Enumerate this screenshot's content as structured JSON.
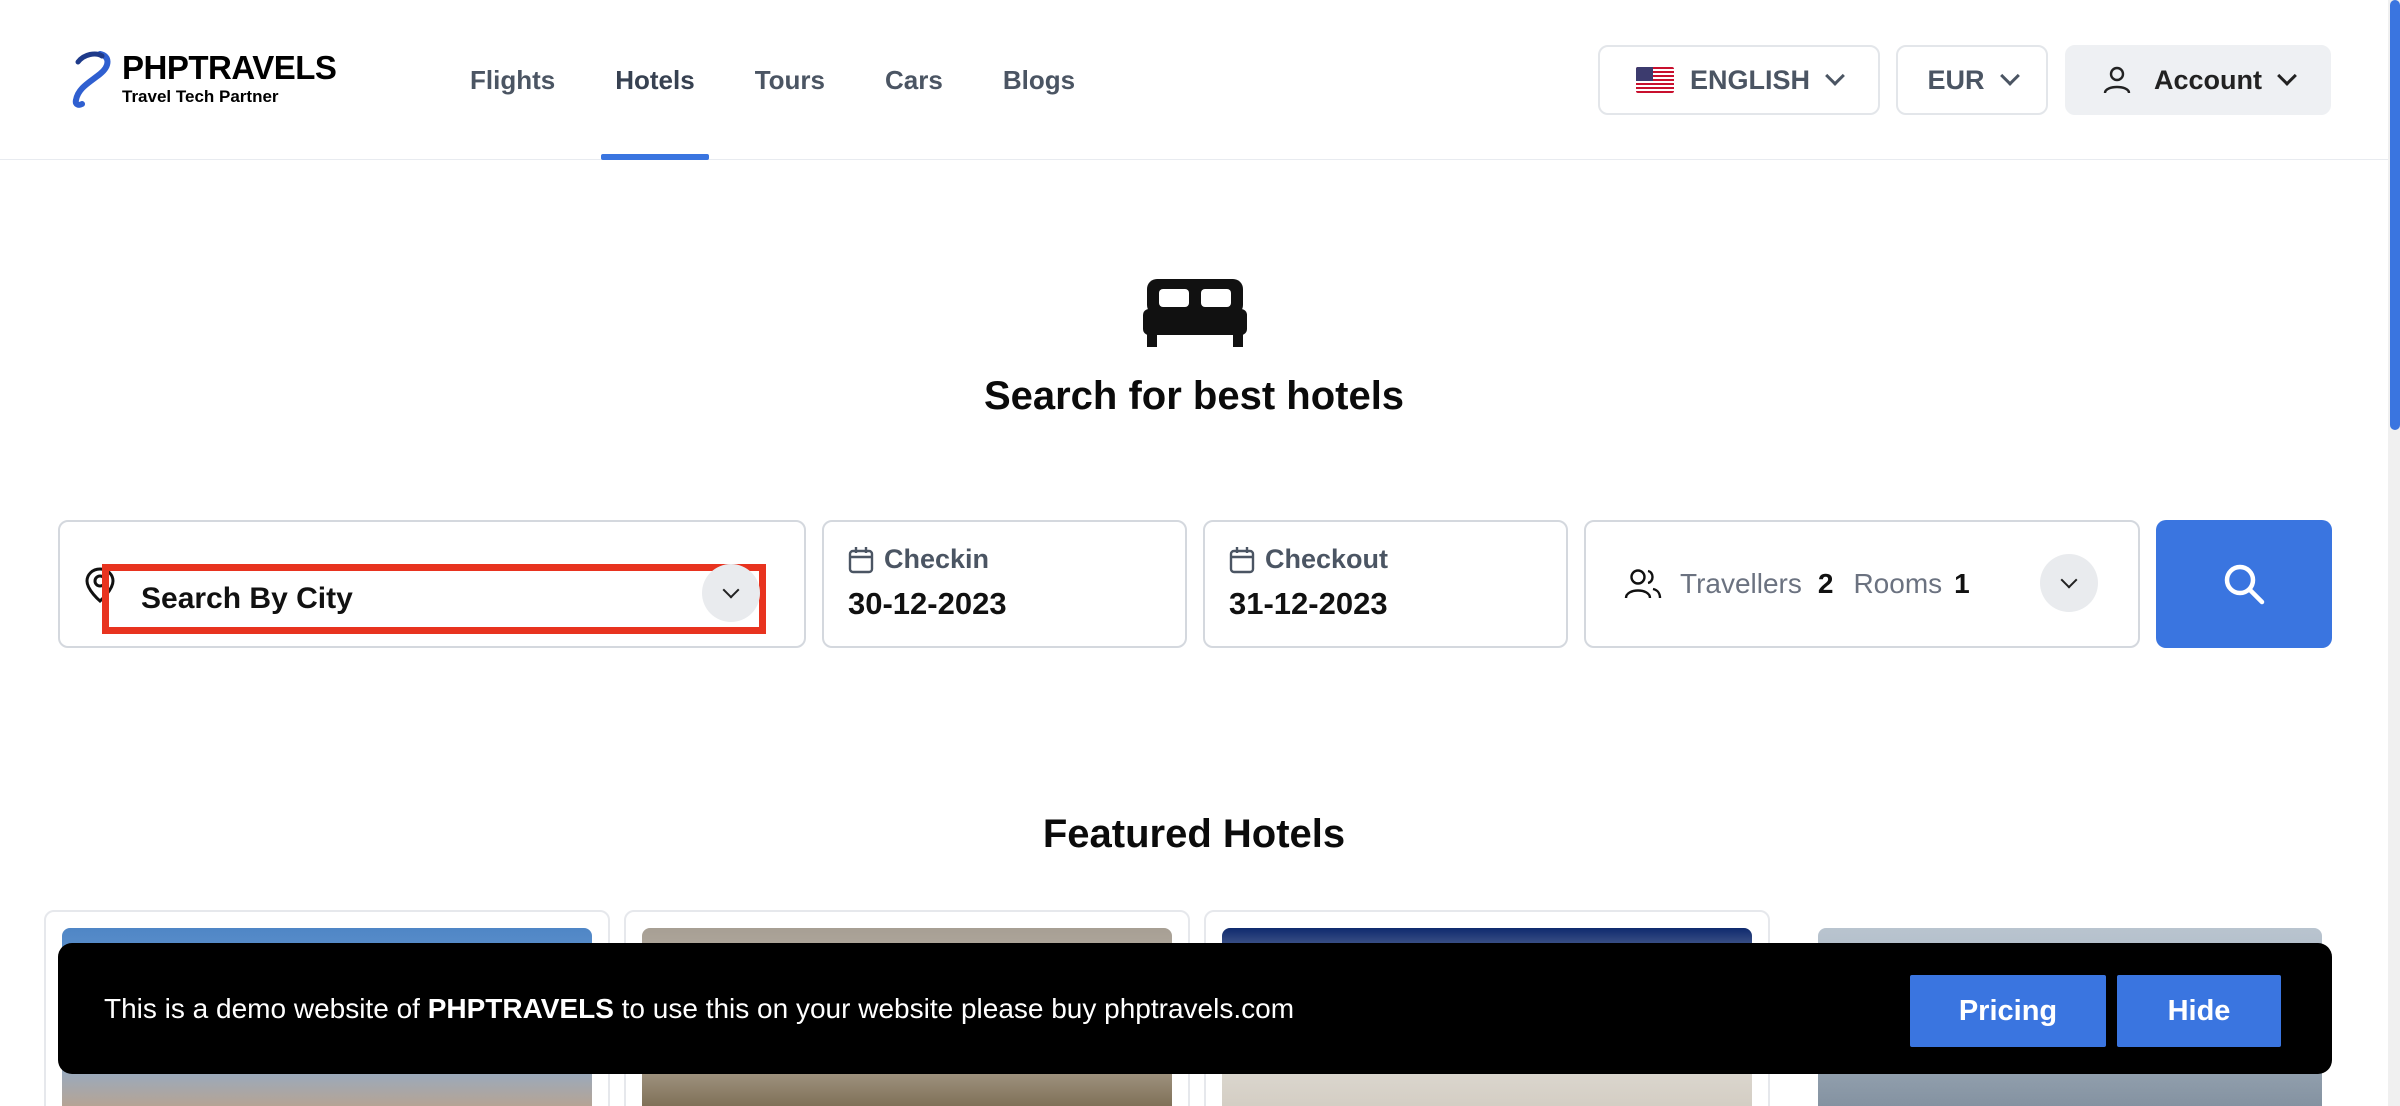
{
  "brand": {
    "name": "PHPTRAVELS",
    "tagline": "Travel Tech Partner",
    "accent": "#3a75e0"
  },
  "nav": {
    "items": [
      {
        "label": "Flights",
        "active": false
      },
      {
        "label": "Hotels",
        "active": true
      },
      {
        "label": "Tours",
        "active": false
      },
      {
        "label": "Cars",
        "active": false
      },
      {
        "label": "Blogs",
        "active": false
      }
    ]
  },
  "header": {
    "language": "ENGLISH",
    "currency": "EUR",
    "account": "Account"
  },
  "hero": {
    "icon": "bed-icon",
    "title": "Search for best hotels"
  },
  "search": {
    "city_label": "Search By City",
    "checkin_label": "Checkin",
    "checkin_value": "30-12-2023",
    "checkout_label": "Checkout",
    "checkout_value": "31-12-2023",
    "travellers_label": "Travellers",
    "travellers_value": "2",
    "rooms_label": "Rooms",
    "rooms_value": "1",
    "highlight_color": "#e8331f"
  },
  "featured": {
    "title": "Featured Hotels"
  },
  "banner": {
    "text_before": "This is a demo website of ",
    "text_brand": "PHPTRAVELS",
    "text_after": " to use this on your website please buy phptravels.com",
    "pricing_label": "Pricing",
    "hide_label": "Hide"
  }
}
